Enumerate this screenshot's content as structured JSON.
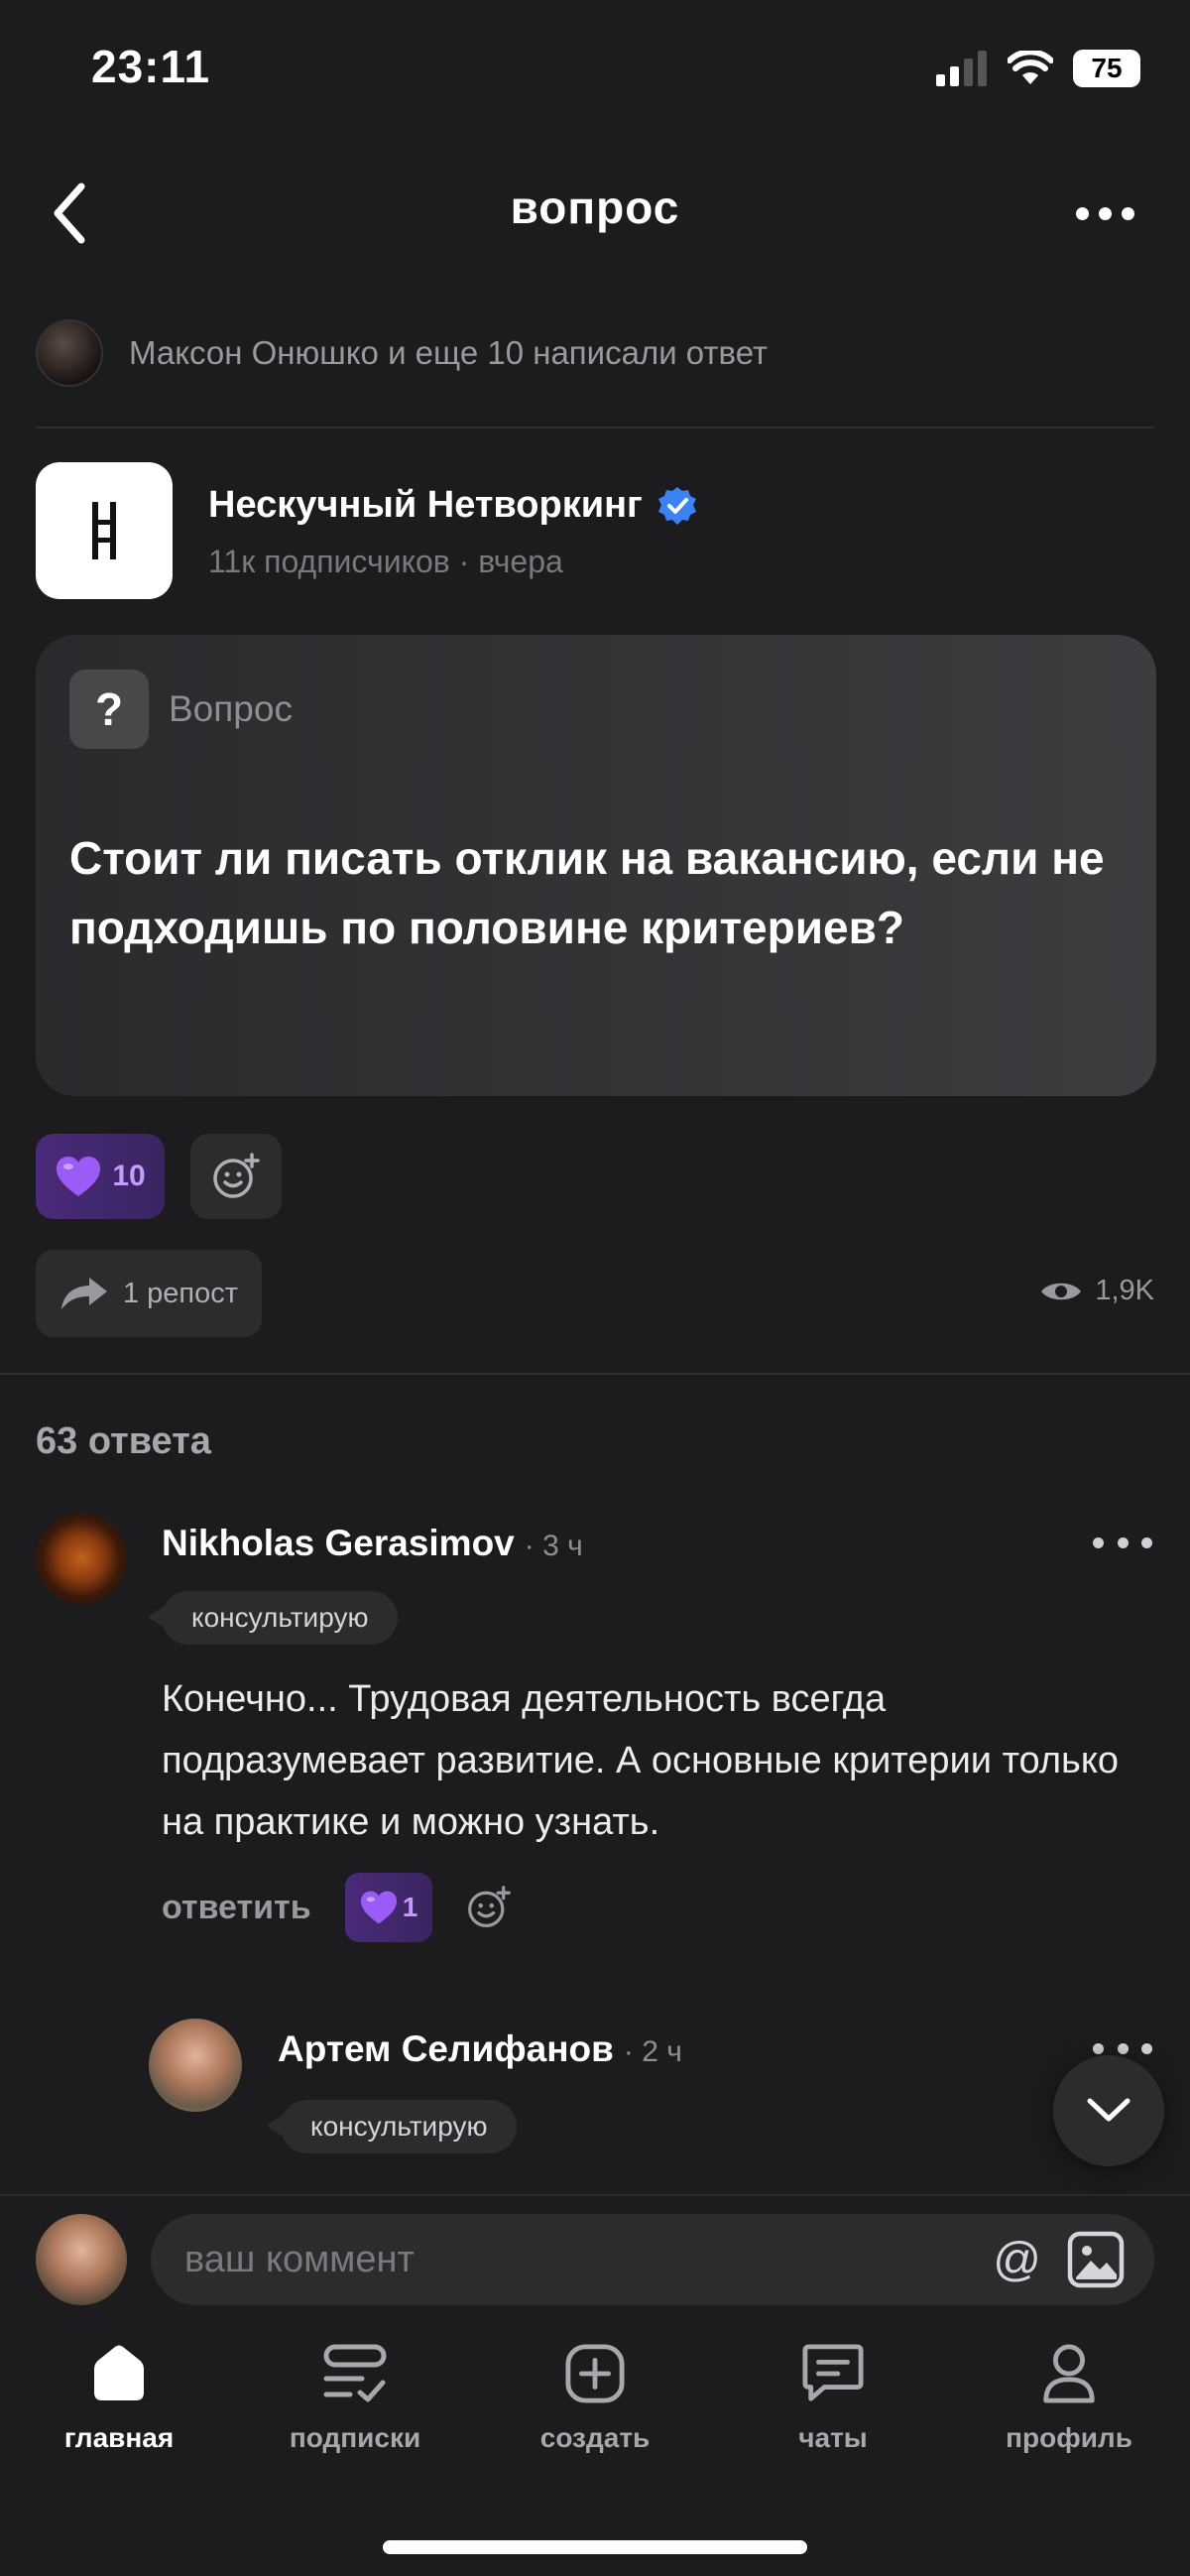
{
  "status": {
    "time": "23:11",
    "battery": "75"
  },
  "header": {
    "title": "вопрос"
  },
  "answered": {
    "text": "Максон Онюшко и еще 10 написали ответ"
  },
  "author": {
    "name": "Нескучный Нетворкинг",
    "meta": "11к подписчиков · вчера"
  },
  "question": {
    "tag": "Вопрос",
    "icon": "?",
    "text": "Стоит ли писать отклик на вакансию, если не подходишь по половине критериев?"
  },
  "reactions": {
    "heart_count": "10"
  },
  "repost": {
    "label": "1 репост"
  },
  "views": {
    "count": "1,9K"
  },
  "answers": {
    "count_label": "63 ответа"
  },
  "comments": [
    {
      "name": "Nikholas Gerasimov",
      "time": "· 3 ч",
      "badge": "консультирую",
      "text": "Конечно... Трудовая деятельность всегда подразумевает развитие. А основные критерии только на практике и можно узнать.",
      "reply_label": "ответить",
      "heart_count": "1"
    },
    {
      "name": "Артем Селифанов",
      "time": "· 2 ч",
      "badge": "консультирую"
    }
  ],
  "comment_input": {
    "placeholder": "ваш коммент",
    "at": "@"
  },
  "tabs": [
    {
      "label": "главная",
      "icon": "home-icon"
    },
    {
      "label": "подписки",
      "icon": "subscriptions-icon"
    },
    {
      "label": "создать",
      "icon": "plus-icon"
    },
    {
      "label": "чаты",
      "icon": "chat-icon"
    },
    {
      "label": "профиль",
      "icon": "profile-icon"
    }
  ],
  "colors": {
    "background": "#1c1c1e",
    "accent": "#8a5cf6",
    "verified": "#3b82f6"
  }
}
